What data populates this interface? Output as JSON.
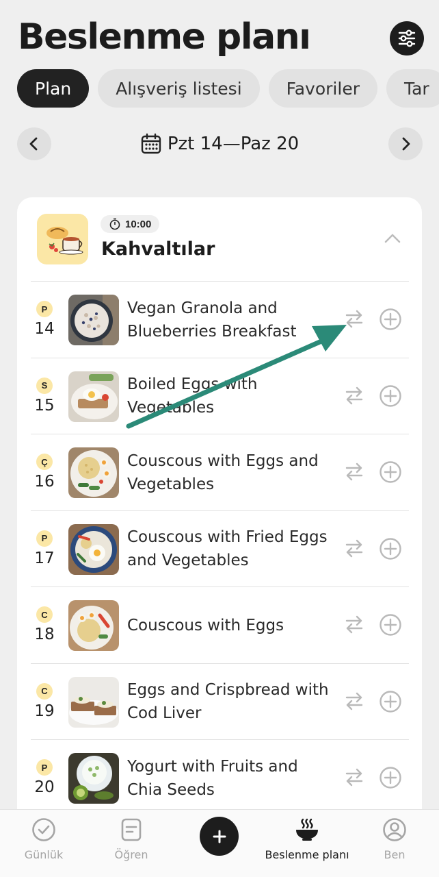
{
  "header": {
    "title": "Beslenme planı"
  },
  "tabs": [
    {
      "label": "Plan",
      "active": true
    },
    {
      "label": "Alışveriş listesi",
      "active": false
    },
    {
      "label": "Favoriler",
      "active": false
    },
    {
      "label": "Tar",
      "active": false
    }
  ],
  "week": {
    "label": "Pzt 14—Paz 20"
  },
  "meal": {
    "time": "10:00",
    "title": "Kahvaltılar"
  },
  "rows": [
    {
      "day_letter": "P",
      "day_number": "14",
      "recipe": "Vegan Granola and Blueberries Breakfast"
    },
    {
      "day_letter": "S",
      "day_number": "15",
      "recipe": "Boiled Eggs with Vegetables"
    },
    {
      "day_letter": "Ç",
      "day_number": "16",
      "recipe": "Couscous with Eggs and Vegetables"
    },
    {
      "day_letter": "P",
      "day_number": "17",
      "recipe": "Couscous with Fried Eggs and Vegetables"
    },
    {
      "day_letter": "C",
      "day_number": "18",
      "recipe": "Couscous with Eggs"
    },
    {
      "day_letter": "C",
      "day_number": "19",
      "recipe": "Eggs and Crispbread with Cod Liver"
    },
    {
      "day_letter": "P",
      "day_number": "20",
      "recipe": "Yogurt with Fruits and Chia Seeds"
    }
  ],
  "bottom_nav": {
    "daily": "Günlük",
    "learn": "Öğren",
    "plan": "Beslenme planı",
    "me": "Ben"
  },
  "colors": {
    "accent_dark": "#1d1d1d",
    "day_badge": "#fbe7a6",
    "annotation_arrow": "#2b8a78"
  }
}
